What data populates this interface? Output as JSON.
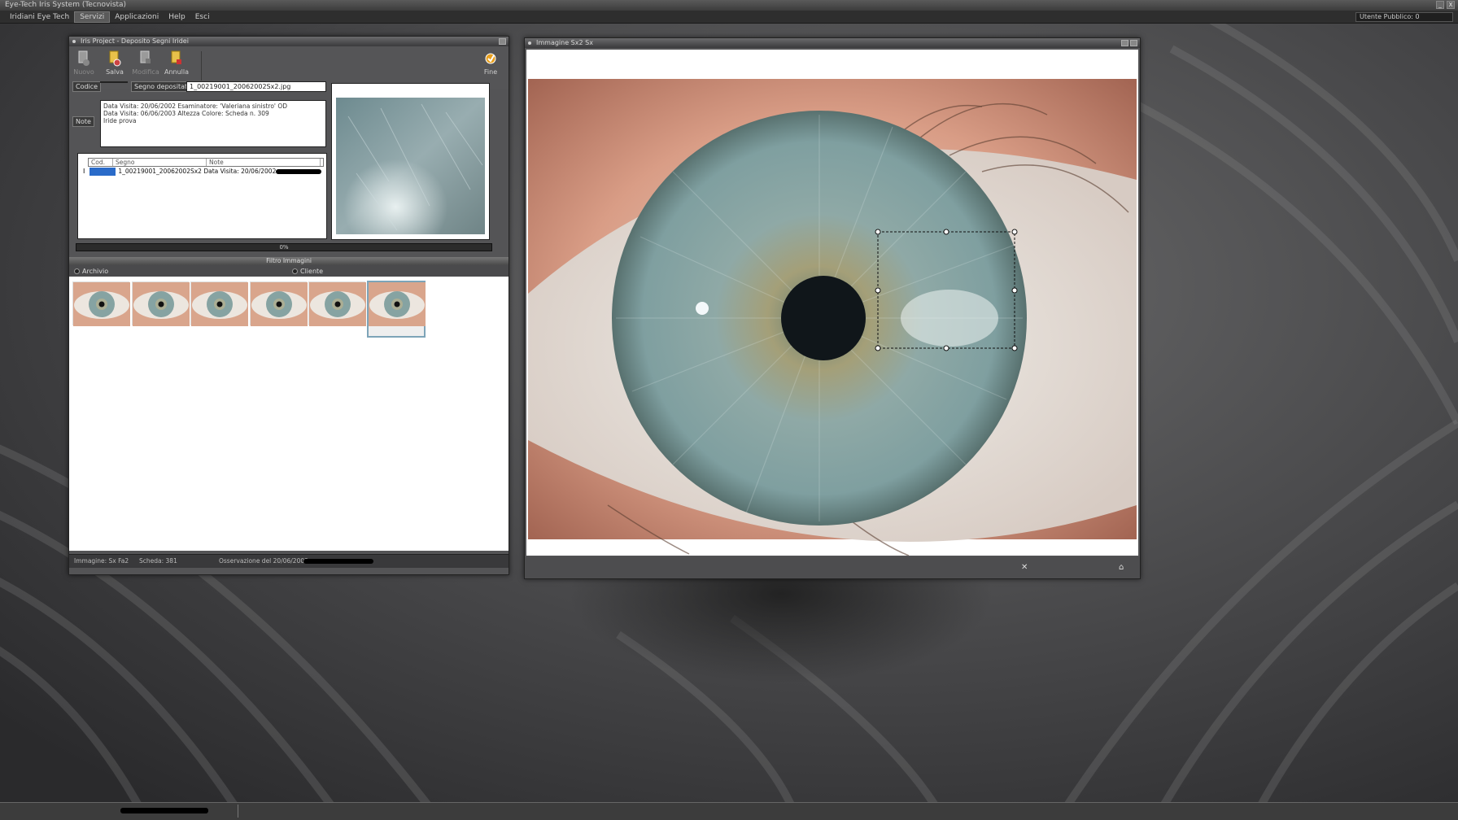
{
  "app": {
    "title": "Eye-Tech Iris System (Tecnovista)",
    "window_buttons": [
      "_",
      "X"
    ]
  },
  "menu": {
    "items": [
      "Iridiani Eye Tech",
      "Servizi",
      "Applicazioni",
      "Help",
      "Esci"
    ],
    "active_index": 1
  },
  "user_status": "Utente Pubblico: 0",
  "project_window": {
    "title": "Iris Project - Deposito Segni Iridei",
    "toolbar": {
      "nuovo": "Nuovo",
      "salva": "Salva",
      "modifica": "Modifica",
      "annulla": "Annulla",
      "fine": "Fine"
    },
    "form": {
      "codice_label": "Codice",
      "codice_value": "",
      "segno_label": "Segno depositato",
      "segno_value": "1_00219001_20062002Sx2.jpg",
      "note_label": "Note",
      "note_lines": [
        "Data Visita: 20/06/2002 Esaminatore: 'Valeriana sinistro' OD",
        "Data Visita: 06/06/2003 Altezza Colore: Scheda n. 309",
        "Iride prova"
      ]
    },
    "grid": {
      "headers": [
        "Cod.",
        "Segno",
        "Note"
      ],
      "rows": [
        {
          "code": "1",
          "text": "1_00219001_20062002Sx2  Data Visita: 20/06/2002"
        }
      ]
    },
    "progress": "0%",
    "filter": {
      "title": "Filtro Immagini",
      "options": [
        "Archivio",
        "Cliente"
      ]
    },
    "thumbnail_count": 6,
    "selected_thumbnail": 5,
    "status": {
      "image": "Immagine: Sx Fa2",
      "scheda": "Scheda: 381",
      "date": "Osservazione del 20/06/2002"
    }
  },
  "image_window": {
    "title": "Immagine Sx2 Sx",
    "footer_icons": [
      "close-x-icon",
      "home-icon"
    ]
  },
  "colors": {
    "desktop": "#3f3f41",
    "window": "#545456",
    "selection": "#2a6bc9",
    "iris": "#7f9fa0"
  }
}
